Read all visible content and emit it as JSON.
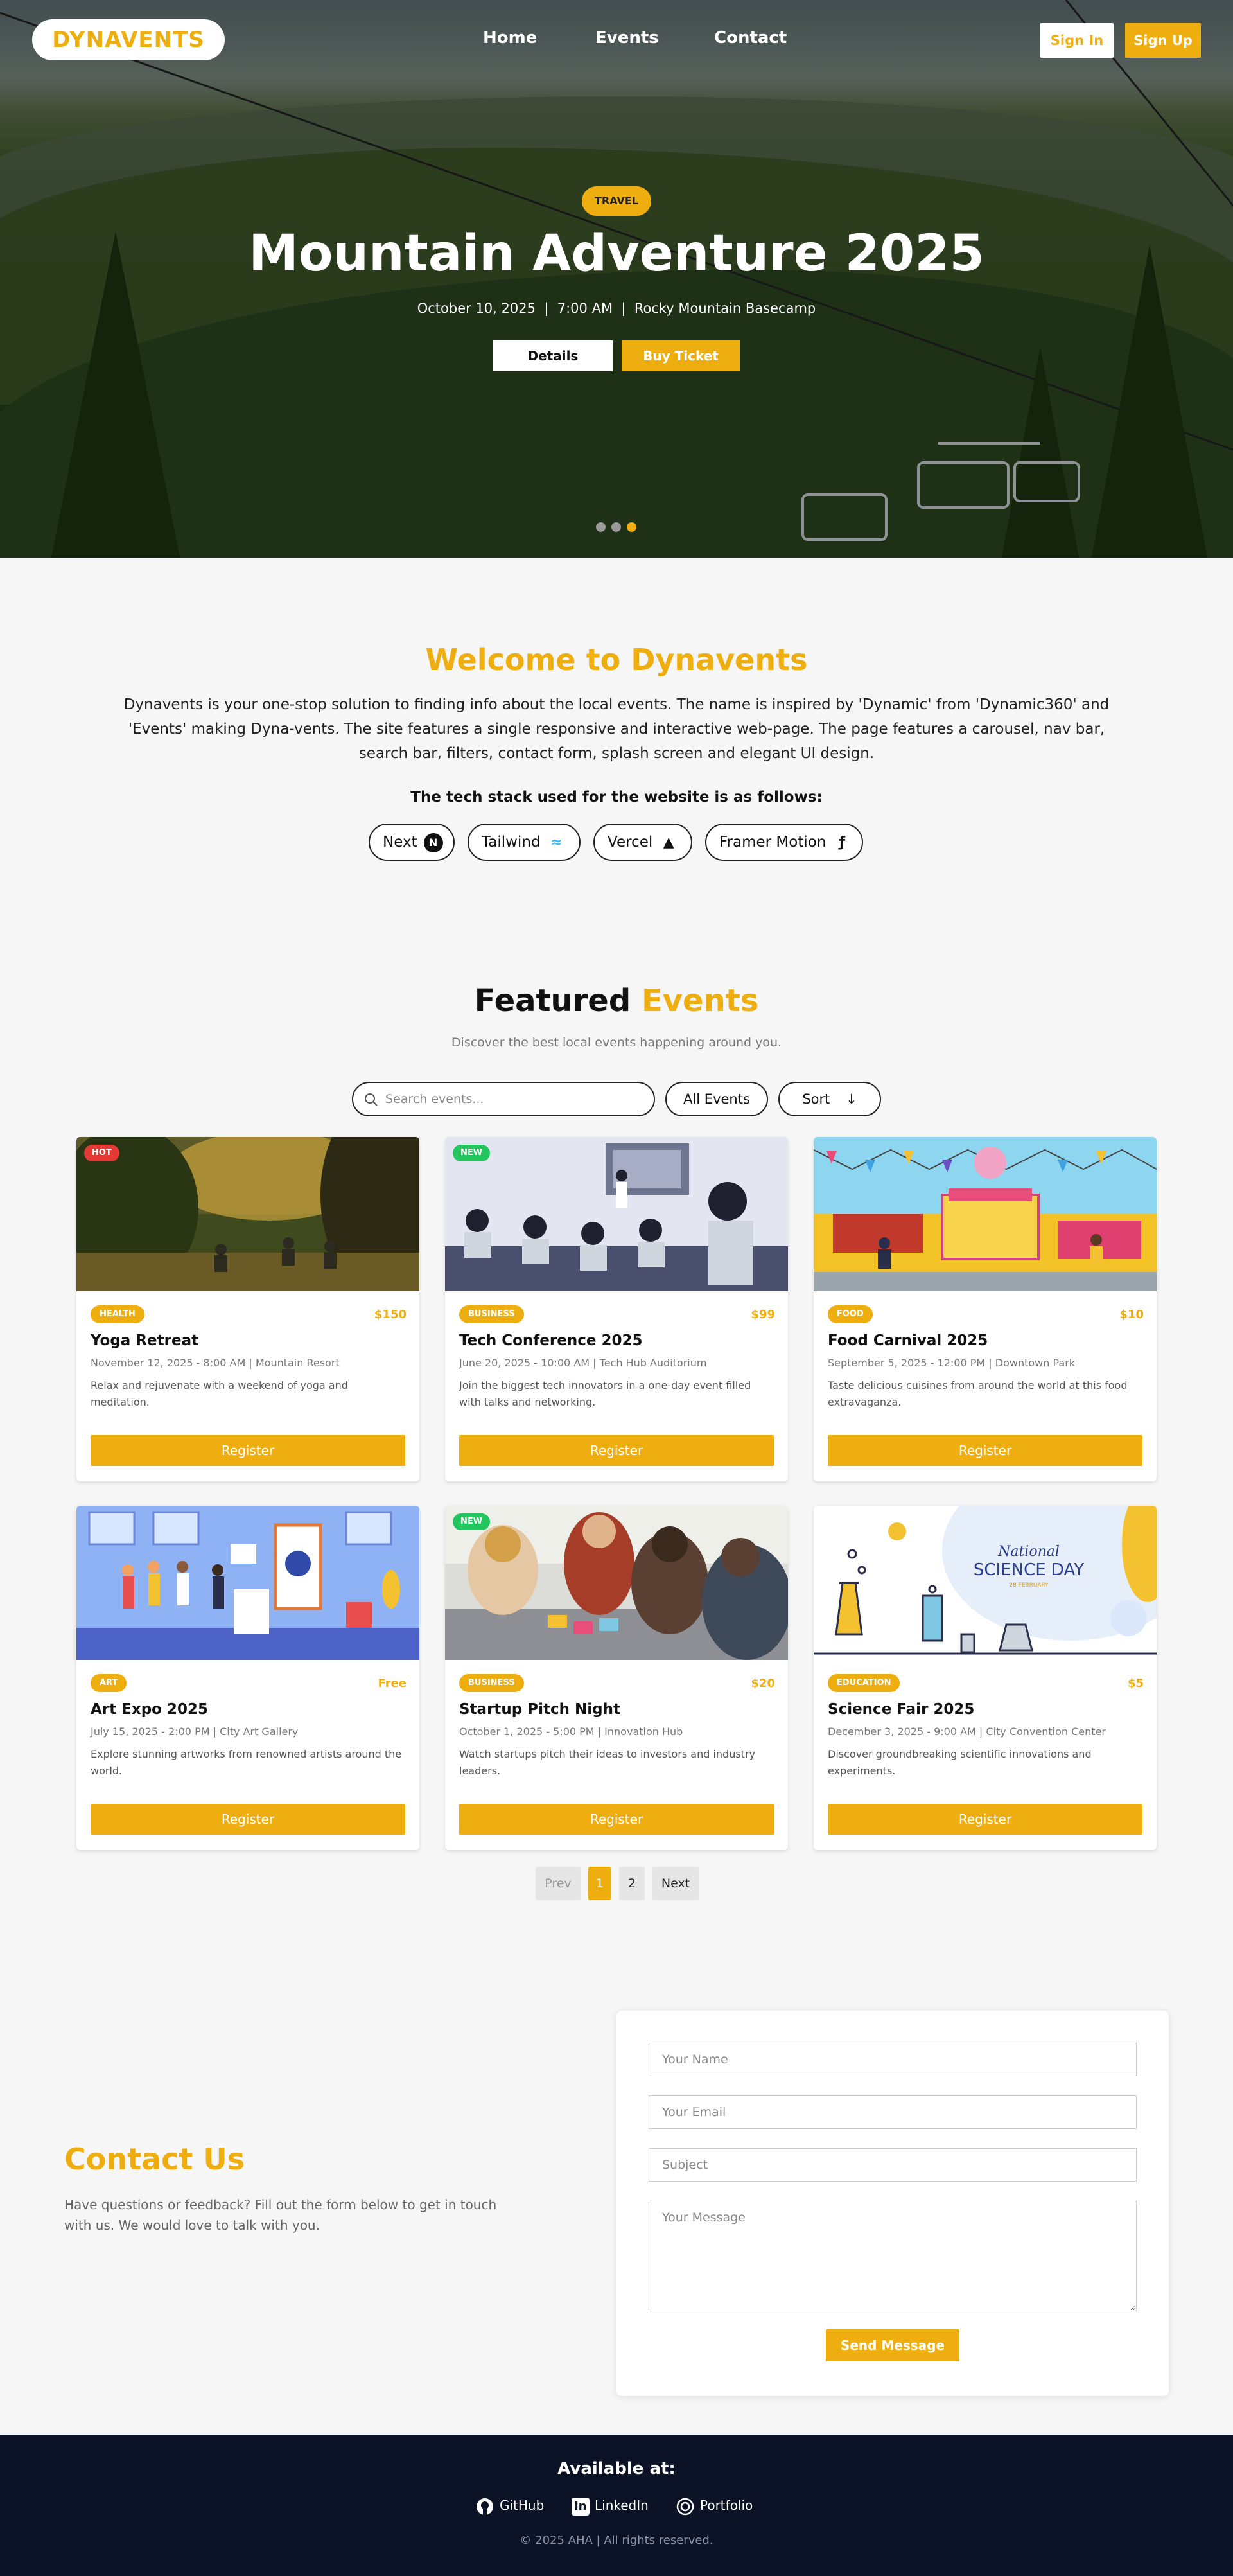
{
  "brand": {
    "name": "DYNAVENTS",
    "accent": "#eeae10",
    "dark": "#0c1326"
  },
  "nav": {
    "items": [
      "Home",
      "Events",
      "Contact"
    ],
    "sign_in": "Sign In",
    "sign_up": "Sign Up"
  },
  "hero": {
    "category": "TRAVEL",
    "title": "Mountain Adventure 2025",
    "meta": "October 10, 2025  |  7:00 AM  |  Rocky Mountain Basecamp",
    "details_label": "Details",
    "buy_label": "Buy Ticket",
    "slides": 3,
    "active_slide": 3
  },
  "welcome": {
    "title": "Welcome to Dynavents",
    "text": "Dynavents is your one-stop solution to finding info about the local events. The name is inspired by 'Dynamic' from 'Dynamic360' and 'Events' making Dyna-vents. The site features a single responsive and interactive web-page. The page features a carousel, nav bar, search bar, filters, contact form, splash screen and elegant UI design.",
    "stack_heading": "The tech stack used for the website is as follows:",
    "stack": [
      {
        "label": "Next",
        "icon": "nextjs-icon"
      },
      {
        "label": "Tailwind",
        "icon": "tailwind-icon"
      },
      {
        "label": "Vercel",
        "icon": "vercel-icon"
      },
      {
        "label": "Framer Motion",
        "icon": "framer-icon"
      }
    ]
  },
  "featured": {
    "title_a": "Featured",
    "title_b": "Events",
    "subtitle": "Discover the best local events happening around you.",
    "search_placeholder": "Search events...",
    "filter_label": "All Events",
    "sort_label": "Sort",
    "register_label": "Register",
    "events": [
      {
        "badge": "HOT",
        "badge_color": "#e53935",
        "category": "HEALTH",
        "price": "$150",
        "title": "Yoga Retreat",
        "meta": "November 12, 2025 - 8:00 AM | Mountain Resort",
        "desc": "Relax and rejuvenate with a weekend of yoga and meditation."
      },
      {
        "badge": "NEW",
        "badge_color": "#22c55e",
        "category": "BUSINESS",
        "price": "$99",
        "title": "Tech Conference 2025",
        "meta": "June 20, 2025 - 10:00 AM | Tech Hub Auditorium",
        "desc": "Join the biggest tech innovators in a one-day event filled with talks and networking."
      },
      {
        "badge": "",
        "badge_color": "",
        "category": "FOOD",
        "price": "$10",
        "title": "Food Carnival 2025",
        "meta": "September 5, 2025 - 12:00 PM | Downtown Park",
        "desc": "Taste delicious cuisines from around the world at this food extravaganza."
      },
      {
        "badge": "",
        "badge_color": "",
        "category": "ART",
        "price": "Free",
        "title": "Art Expo 2025",
        "meta": "July 15, 2025 - 2:00 PM | City Art Gallery",
        "desc": "Explore stunning artworks from renowned artists around the world."
      },
      {
        "badge": "NEW",
        "badge_color": "#22c55e",
        "category": "BUSINESS",
        "price": "$20",
        "title": "Startup Pitch Night",
        "meta": "October 1, 2025 - 5:00 PM | Innovation Hub",
        "desc": "Watch startups pitch their ideas to investors and industry leaders."
      },
      {
        "badge": "",
        "badge_color": "",
        "category": "EDUCATION",
        "price": "$5",
        "title": "Science Fair 2025",
        "meta": "December 3, 2025 - 9:00 AM | City Convention Center",
        "desc": "Discover groundbreaking scientific innovations and experiments.",
        "image_text_a": "National",
        "image_text_b": "SCIENCE DAY",
        "image_text_c": "28 FEBRUARY"
      }
    ],
    "pagination": {
      "prev": "Prev",
      "pages": [
        "1",
        "2"
      ],
      "current": "1",
      "next": "Next"
    }
  },
  "contact": {
    "title": "Contact Us",
    "text": "Have questions or feedback? Fill out the form below to get in touch with us. We would love to talk with you.",
    "name_placeholder": "Your Name",
    "email_placeholder": "Your Email",
    "subject_placeholder": "Subject",
    "message_placeholder": "Your Message",
    "send_label": "Send Message"
  },
  "footer": {
    "title": "Available at:",
    "links": [
      {
        "label": "GitHub",
        "icon": "github-icon"
      },
      {
        "label": "LinkedIn",
        "icon": "linkedin-icon"
      },
      {
        "label": "Portfolio",
        "icon": "portfolio-icon"
      }
    ],
    "copyright": "© 2025 AHA | All rights reserved."
  }
}
